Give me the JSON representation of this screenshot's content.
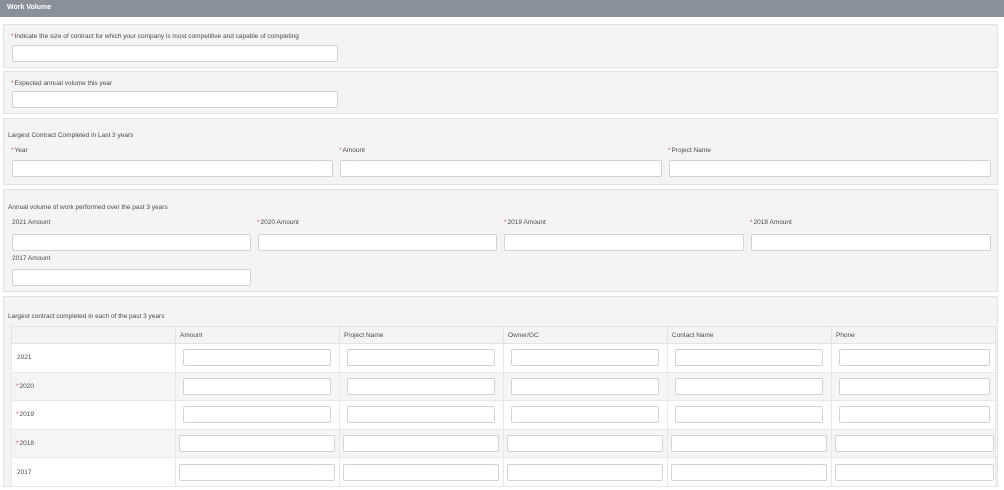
{
  "header": {
    "title": "Work Volume"
  },
  "contract_size": {
    "required_mark": "*",
    "label": "Indicate the size of contract for which your company is most competitive and capable of completing"
  },
  "annual_volume": {
    "required_mark": "*",
    "label": "Expected annual volume this year"
  },
  "largest_contract": {
    "section_title": "Largest Contract Completed in Last 3 years",
    "fields": [
      {
        "label": "Year",
        "required_mark": "*"
      },
      {
        "label": "Amount",
        "required_mark": "*"
      },
      {
        "label": "Project Name",
        "required_mark": "*"
      }
    ]
  },
  "annual_work": {
    "section_title": "Annual volume of work performed over the past 3 years",
    "fields": [
      {
        "label": "2021 Amount",
        "required_mark": ""
      },
      {
        "label": "2020 Amount",
        "required_mark": "*"
      },
      {
        "label": "2019 Amount",
        "required_mark": "*"
      },
      {
        "label": "2018 Amount",
        "required_mark": "*"
      },
      {
        "label": "2017 Amount",
        "required_mark": ""
      }
    ]
  },
  "yearly_contracts": {
    "section_title": "Largest contract completed in each of the past 3 years",
    "columns": [
      "",
      "Amount",
      "Project Name",
      "Owner/GC",
      "Contact Name",
      "Phone"
    ],
    "rows": [
      {
        "year": "2021",
        "required_mark": ""
      },
      {
        "year": "2020",
        "required_mark": "*"
      },
      {
        "year": "2019",
        "required_mark": "*"
      },
      {
        "year": "2018",
        "required_mark": "*"
      },
      {
        "year": "2017",
        "required_mark": ""
      }
    ]
  }
}
